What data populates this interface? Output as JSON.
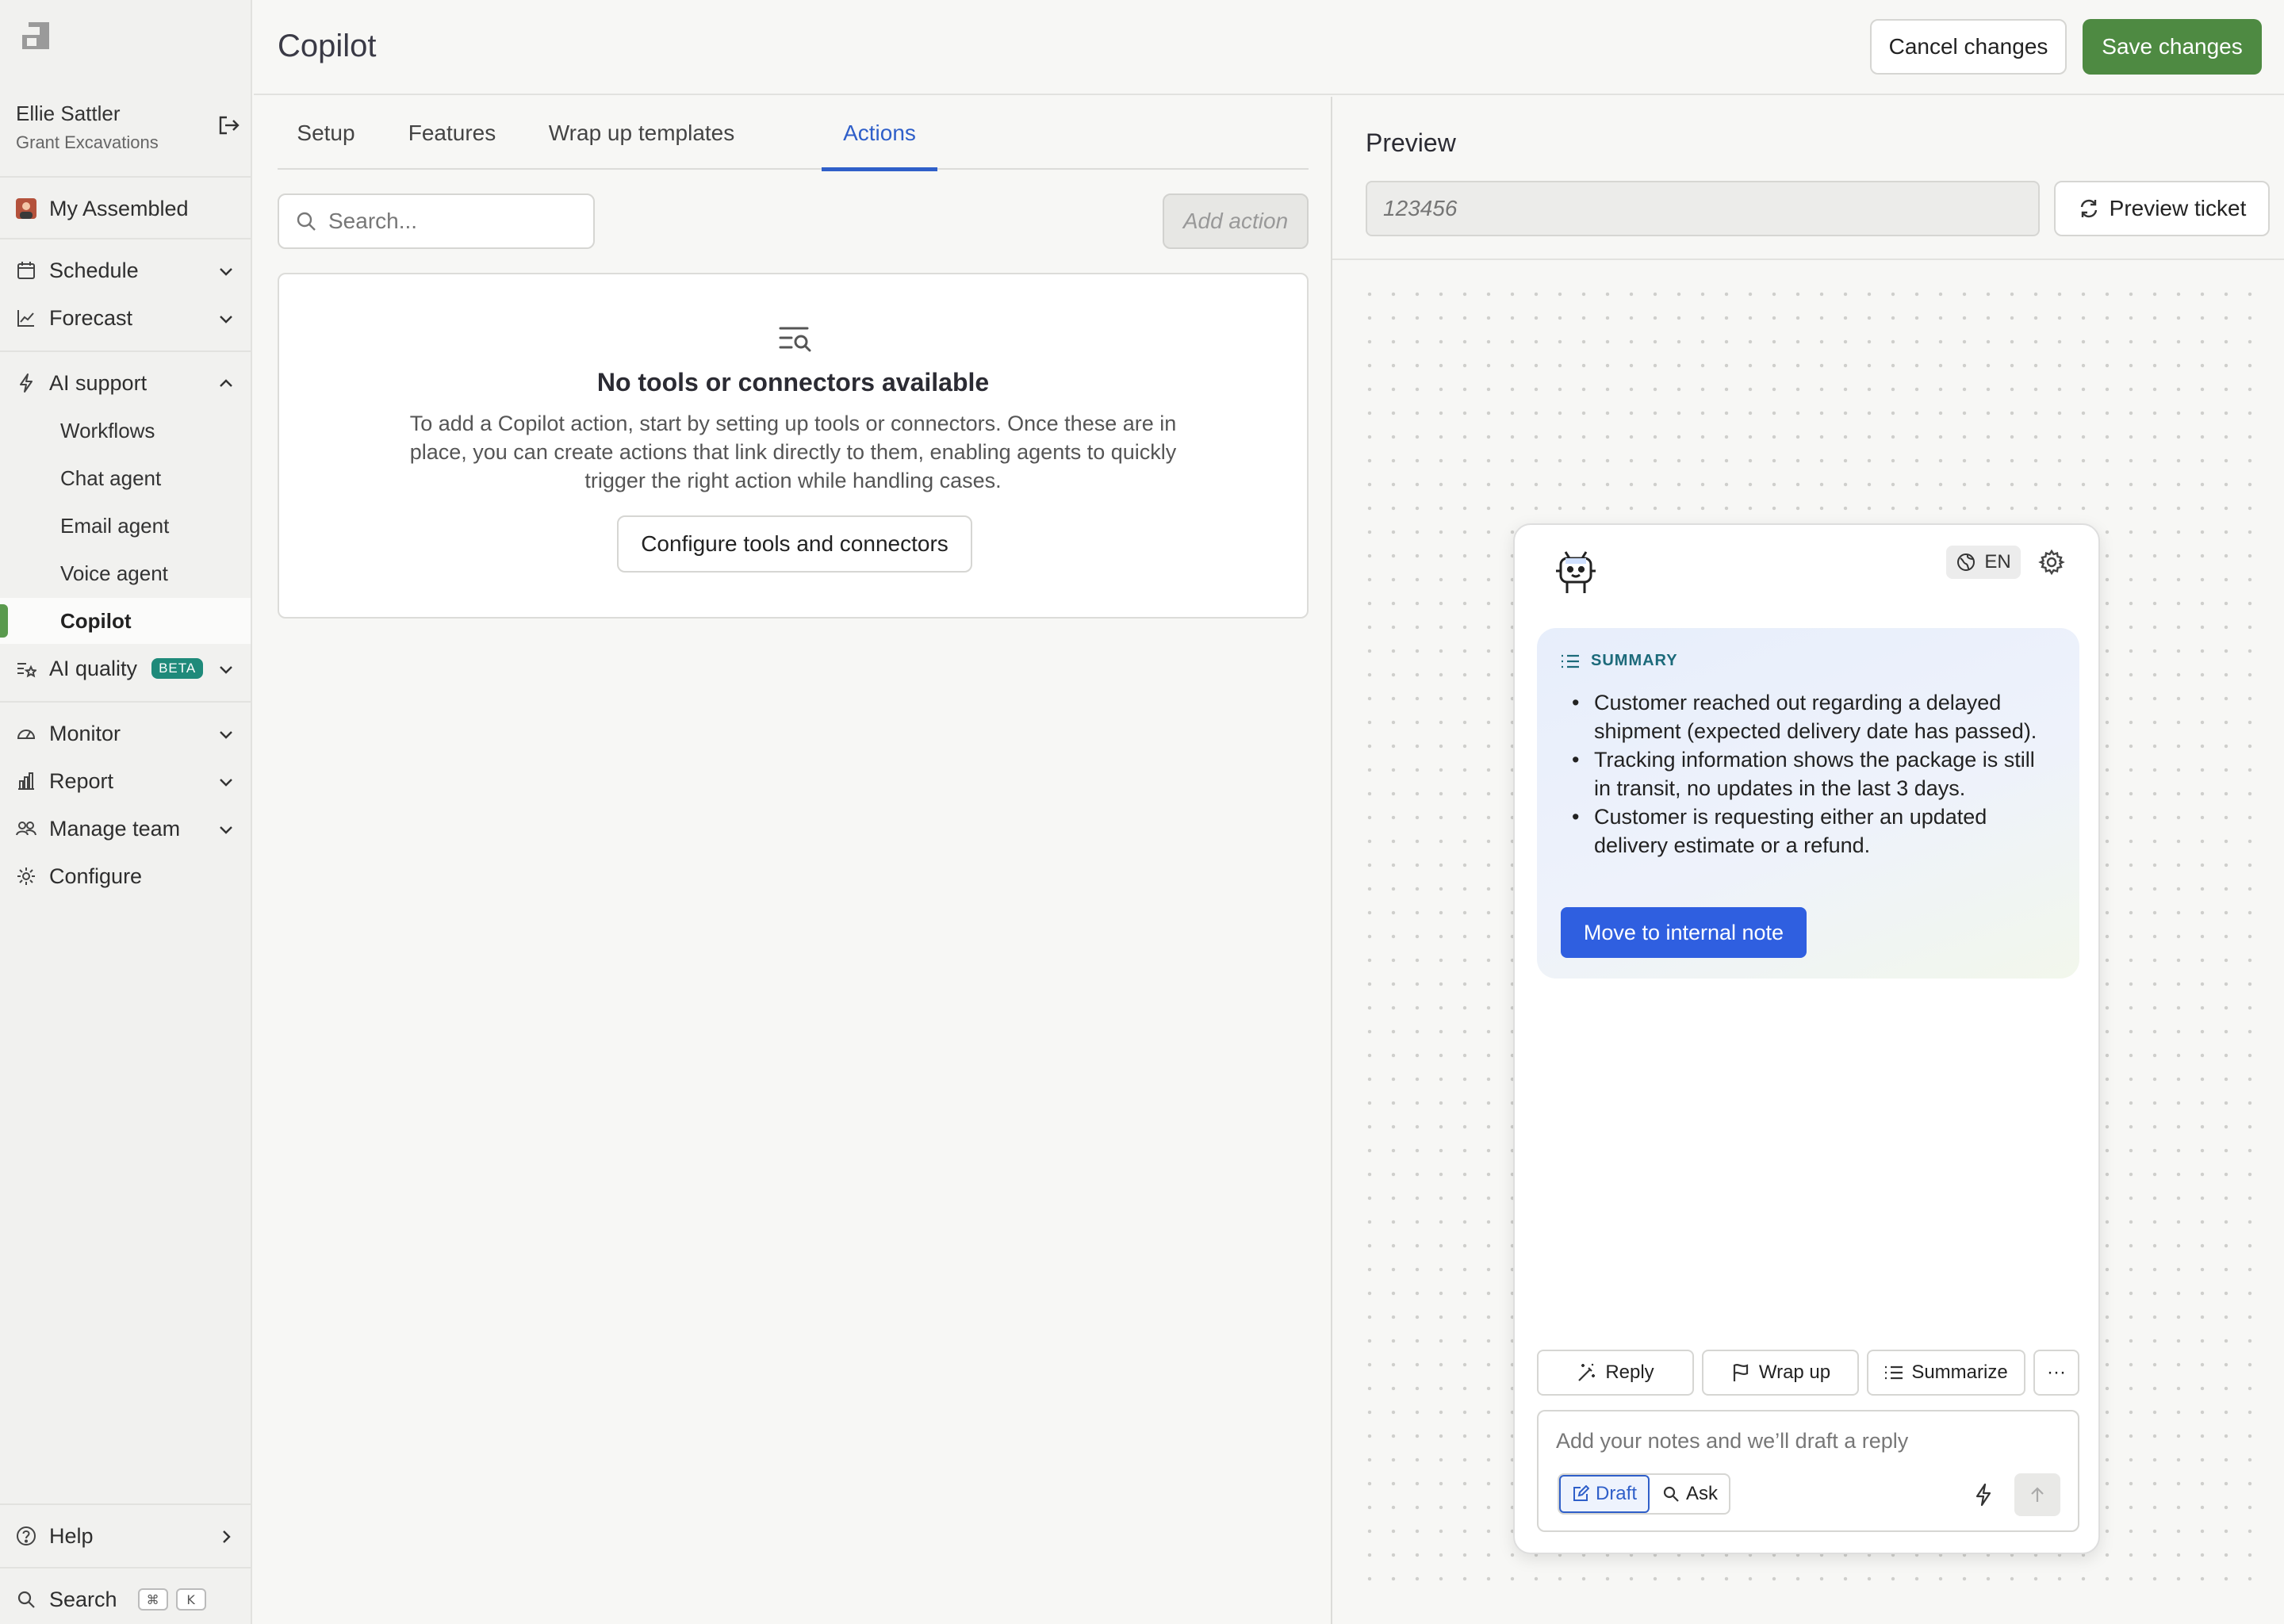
{
  "app": {
    "page_title": "Copilot"
  },
  "user": {
    "name": "Ellie Sattler",
    "org": "Grant Excavations"
  },
  "sidebar": {
    "my_assembled": "My Assembled",
    "schedule": "Schedule",
    "forecast": "Forecast",
    "ai_support": "AI support",
    "sub_items": [
      "Workflows",
      "Chat agent",
      "Email agent",
      "Voice agent",
      "Copilot"
    ],
    "ai_quality": "AI quality",
    "beta_badge": "BETA",
    "monitor": "Monitor",
    "report": "Report",
    "manage_team": "Manage team",
    "configure": "Configure",
    "help": "Help",
    "search": "Search",
    "shortcut_cmd": "⌘",
    "shortcut_key": "K"
  },
  "header": {
    "cancel_label": "Cancel changes",
    "save_label": "Save changes"
  },
  "tabs": [
    "Setup",
    "Features",
    "Wrap up templates",
    "Actions"
  ],
  "actions": {
    "search_placeholder": "Search...",
    "add_action_label": "Add action",
    "empty_title": "No tools or connectors available",
    "empty_description": "To add a Copilot action, start by setting up tools or connectors. Once these are in place, you can create actions that link directly to them, enabling agents to quickly trigger the right action while handling cases.",
    "configure_label": "Configure tools and connectors"
  },
  "preview": {
    "title": "Preview",
    "ticket_placeholder": "123456",
    "preview_ticket_label": "Preview ticket"
  },
  "widget": {
    "language": "EN",
    "summary_heading": "SUMMARY",
    "summary_items": [
      "Customer reached out regarding a delayed shipment (expected delivery date has passed).",
      "Tracking information shows the package is still in transit, no updates in the last 3 days.",
      "Customer is requesting either an updated delivery estimate or a refund."
    ],
    "move_label": "Move to internal note",
    "reply_label": "Reply",
    "wrapup_label": "Wrap up",
    "summarize_label": "Summarize",
    "more_label": "···",
    "composer_placeholder": "Add your notes and we’ll draft a reply",
    "draft_label": "Draft",
    "ask_label": "Ask"
  },
  "colors": {
    "accent_blue": "#2f5fc9",
    "save_green": "#4e8a42",
    "active_marker": "#5a9a4e",
    "beta_badge": "#1f8a7a"
  }
}
